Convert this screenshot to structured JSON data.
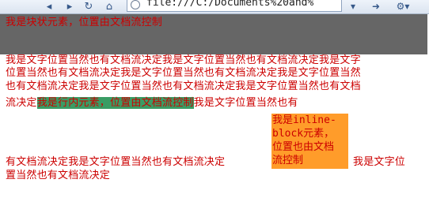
{
  "browser": {
    "address_url": "file:///C:/Documents%20and%",
    "back_icon": "back-arrow-icon",
    "reload_icon": "reload-icon",
    "page_icon": "page-globe-icon"
  },
  "colors": {
    "text": "#cc0000",
    "block_bg": "#666666",
    "inline_bg": "#3a9c64",
    "inline_block_bg": "#ff9c2a"
  },
  "content": {
    "block_text": "我是块状元素，位置由文档流控制",
    "line1": "我是文字位置当然也有文档流决定我是文字位置当然也有文档流决定我是文字",
    "line2": "位置当然也有文档流决定我是文字位置当然也有文档流决定我是文字位置当然",
    "line3": "也有文档流决定我是文字位置当然也有文档流决定我是文字位置当然也有文档",
    "line4_pre": "流决定",
    "inline_text": "我是行内元素，位置由文档流控制",
    "line4_post": "我是文字位置当然也有",
    "inline_block_line1": "我是inline-",
    "inline_block_line2": "block元素，",
    "inline_block_line3": "位置也由文档",
    "inline_block_line4": "流控制",
    "line5_pre": "有文档流决定我是文字位置当然也有文档流决定",
    "line5_post": "我是文字位",
    "line6": "置当然也有文档流决定"
  }
}
